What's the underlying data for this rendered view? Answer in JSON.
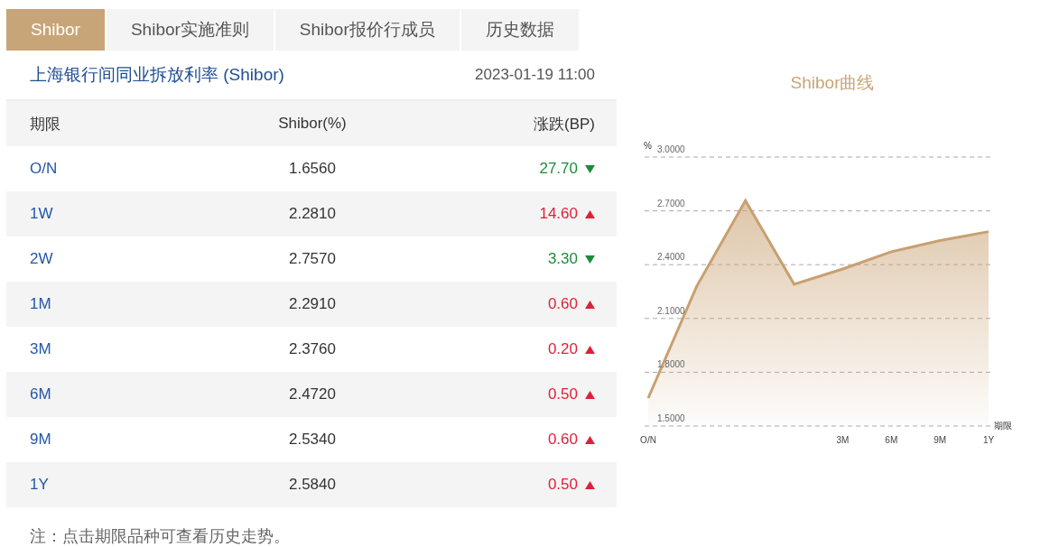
{
  "tabs": [
    {
      "label": "Shibor",
      "selected": true
    },
    {
      "label": "Shibor实施准则",
      "selected": false
    },
    {
      "label": "Shibor报价行成员",
      "selected": false
    },
    {
      "label": "历史数据",
      "selected": false
    }
  ],
  "table_title": "上海银行间同业拆放利率 (Shibor)",
  "timestamp": "2023-01-19 11:00",
  "table": {
    "columns": [
      "期限",
      "Shibor(%)",
      "涨跌(BP)"
    ],
    "rows": [
      {
        "term": "O/N",
        "rate": "1.6560",
        "change": "27.70",
        "rising": false
      },
      {
        "term": "1W",
        "rate": "2.2810",
        "change": "14.60",
        "rising": true
      },
      {
        "term": "2W",
        "rate": "2.7570",
        "change": "3.30",
        "rising": false
      },
      {
        "term": "1M",
        "rate": "2.2910",
        "change": "0.60",
        "rising": true
      },
      {
        "term": "3M",
        "rate": "2.3760",
        "change": "0.20",
        "rising": true
      },
      {
        "term": "6M",
        "rate": "2.4720",
        "change": "0.50",
        "rising": true
      },
      {
        "term": "9M",
        "rate": "2.5340",
        "change": "0.60",
        "rising": true
      },
      {
        "term": "1Y",
        "rate": "2.5840",
        "change": "0.50",
        "rising": true
      }
    ]
  },
  "note": "注：点击期限品种可查看历史走势。",
  "chart": {
    "chart_data": {
      "type": "area",
      "title": "Shibor曲线",
      "xlabel": "期限",
      "ylabel": "%",
      "categories": [
        "O/N",
        null,
        null,
        null,
        "3M",
        "6M",
        "9M",
        "1Y"
      ],
      "series": [
        {
          "color": "#c8a070",
          "values": [
            1.656,
            2.281,
            2.757,
            2.291,
            2.376,
            2.472,
            2.534,
            2.584
          ]
        }
      ],
      "ylim": [
        1.5,
        3.0
      ],
      "grid": true,
      "yticks": [
        {
          "value": 1.5,
          "label": "1.5000"
        },
        {
          "value": 1.8,
          "label": "1.8000"
        },
        {
          "value": 2.1,
          "label": "2.1000"
        },
        {
          "value": 2.4,
          "label": "2.4000"
        },
        {
          "value": 2.7,
          "label": "2.7000"
        },
        {
          "value": 3.0,
          "label": "3.0000"
        }
      ]
    }
  }
}
